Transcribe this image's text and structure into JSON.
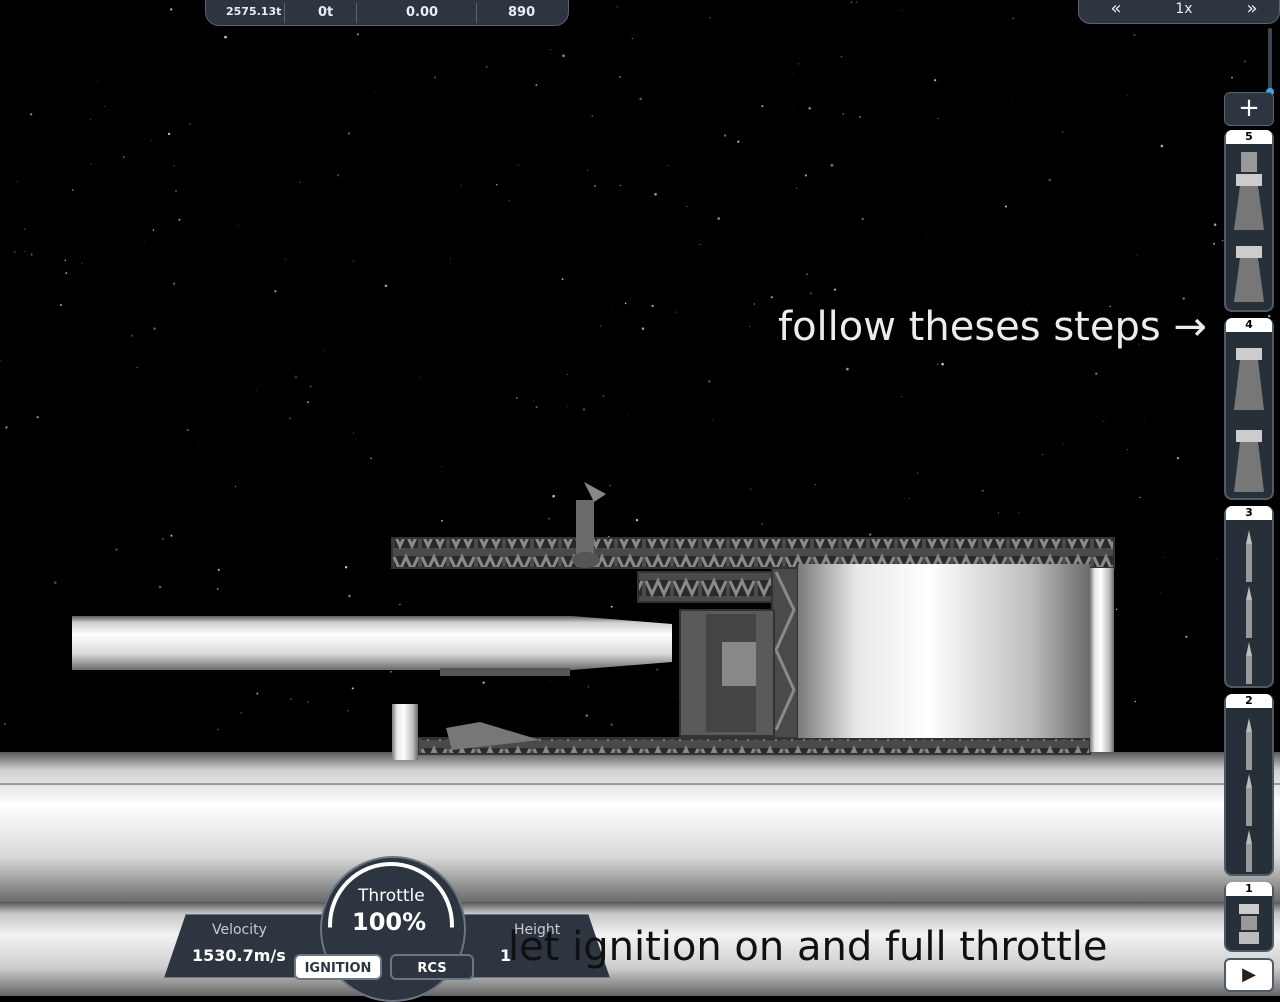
{
  "top_stats": {
    "mass": "2575.13t",
    "fuel": "0t",
    "thrust_to_weight": "0.00",
    "parts": "890"
  },
  "time_warp": {
    "slow_label": "«",
    "speed": "1x",
    "fast_label": "»"
  },
  "staging": {
    "add_stage_label": "+",
    "stages": [
      {
        "number": "5",
        "contents": "engines"
      },
      {
        "number": "4",
        "contents": "engines"
      },
      {
        "number": "3",
        "contents": "separators"
      },
      {
        "number": "2",
        "contents": "separators"
      },
      {
        "number": "1",
        "contents": "engine"
      }
    ],
    "activate_stage_label": "▶"
  },
  "annotations": {
    "steps_text": "follow theses steps →",
    "ignition_text": "let ignition on and full throttle"
  },
  "hud": {
    "velocity_label": "Velocity",
    "velocity_value": "1530.7m/s",
    "throttle_label": "Throttle",
    "throttle_value": "100%",
    "height_label": "Height",
    "height_value": "1",
    "ignition_label": "IGNITION",
    "rcs_label": "RCS"
  },
  "colors": {
    "panel": "#2c3540",
    "accent": "#3aa6ff"
  },
  "icons": {
    "slow_warp": "double-chevron-left-icon",
    "fast_warp": "double-chevron-right-icon",
    "play": "play-icon"
  }
}
